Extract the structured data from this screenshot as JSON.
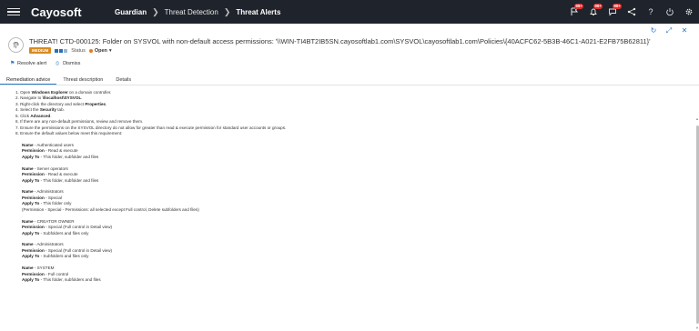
{
  "app": {
    "logo": "Cayosoft",
    "breadcrumb": [
      "Guardian",
      "Threat Detection",
      "Threat Alerts"
    ],
    "badges": {
      "notifications": "99+",
      "alerts": "99+",
      "tasks": "99+"
    }
  },
  "threat": {
    "title": "THREAT! CTD-000125: Folder on SYSVOL with non-default access permissions: '\\\\WIN-TI4BT2IB5SN.cayosoftlab1.com\\SYSVOL\\cayosoftlab1.com\\Policies\\{40ACFC62-5B3B-46C1-A021-E2FB75B62811}'",
    "severity": "MEDIUM",
    "status_label": "Status",
    "status_value": "Open"
  },
  "actions": {
    "resolve": "Resolve alert",
    "dismiss": "Dismiss"
  },
  "tabs": [
    "Remediation advice",
    "Threat description",
    "Details"
  ],
  "steps": [
    [
      {
        "t": "1. Open "
      },
      {
        "t": "Windows Explorer",
        "b": true
      },
      {
        "t": " on a domain controller."
      }
    ],
    [
      {
        "t": "2. Navigate to "
      },
      {
        "t": "\\\\localhost\\SYSVOL",
        "b": true
      },
      {
        "t": "."
      }
    ],
    [
      {
        "t": "3. Right-click the directory and select "
      },
      {
        "t": "Properties",
        "b": true
      },
      {
        "t": "."
      }
    ],
    [
      {
        "t": "4. Select the "
      },
      {
        "t": "Security",
        "b": true
      },
      {
        "t": " tab."
      }
    ],
    [
      {
        "t": "5. Click "
      },
      {
        "t": "Advanced",
        "b": true
      },
      {
        "t": "."
      }
    ],
    [
      {
        "t": "6. If there are any non-default permissions, review and remove them."
      }
    ],
    [
      {
        "t": "7. Ensure the permissions on the SYSVOL directory do not allow for greater than read & execute permission for standard user accounts or groups."
      }
    ],
    [
      {
        "t": "8. Ensure the default values below meet this requirement:"
      }
    ]
  ],
  "permissions": [
    {
      "name": "Authenticated users",
      "permission": "Read & execute",
      "apply_to": "This folder, subfolder and files",
      "note": ""
    },
    {
      "name": "Server operators",
      "permission": "Read & execute",
      "apply_to": "This folder, subfolder and files",
      "note": ""
    },
    {
      "name": "Administrators",
      "permission": "Special",
      "apply_to": "This folder only",
      "note": "(Permission - Special - Permissions: all selected except Full control, Delete subfolders and files)"
    },
    {
      "name": "CREATOR OWNER",
      "permission": "Special (Full control in Detail view)",
      "apply_to": "Subfolders and files only",
      "note": ""
    },
    {
      "name": "Administrators",
      "permission": "Special (Full control in Detail view)",
      "apply_to": "Subfolders and files only",
      "note": ""
    },
    {
      "name": "SYSTEM",
      "permission": "Full control",
      "apply_to": "This folder, subfolders and files",
      "note": ""
    }
  ],
  "field_labels": {
    "name": "Name",
    "permission": "Permission",
    "apply_to": "Apply To",
    "sep": " - "
  }
}
